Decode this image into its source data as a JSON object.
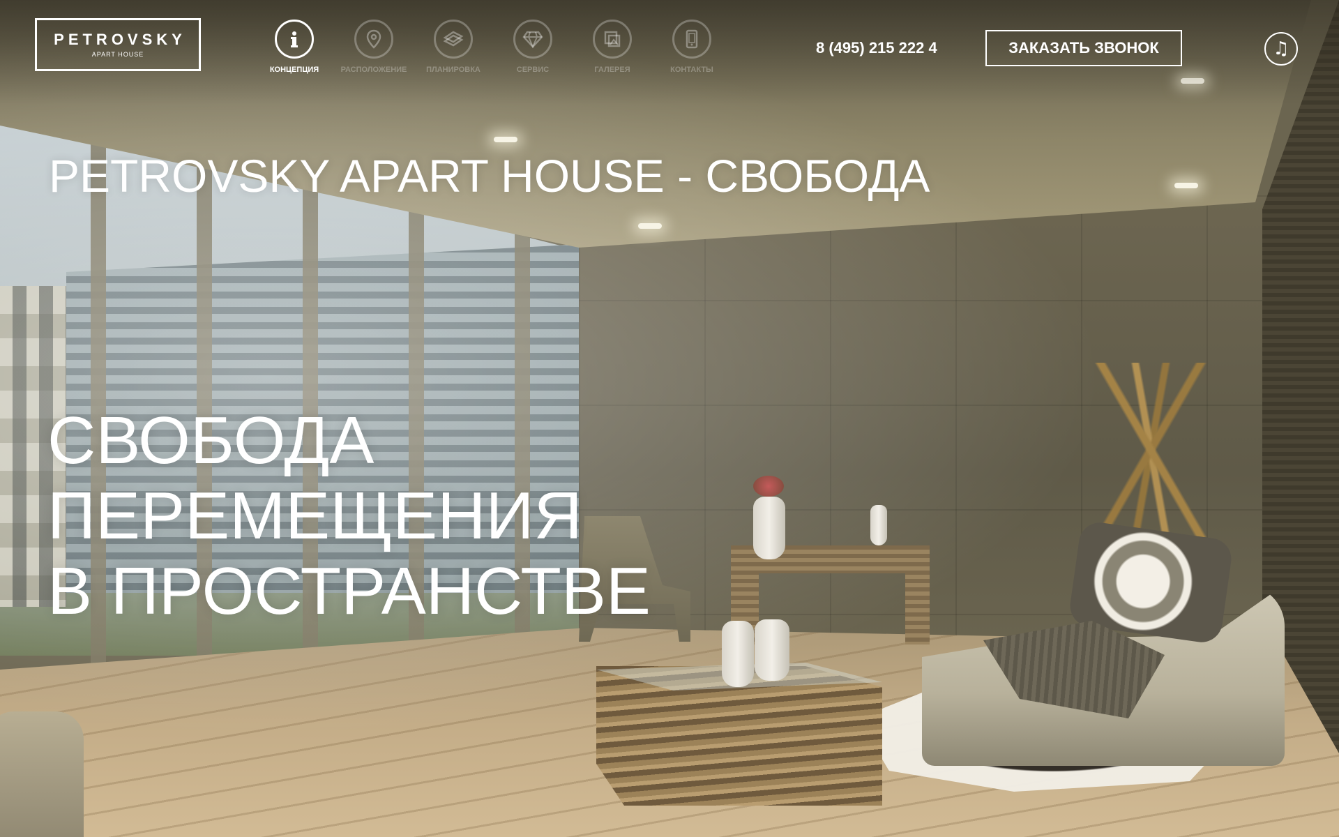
{
  "brand": {
    "name": "PETROVSKY",
    "tagline": "APART HOUSE"
  },
  "nav": {
    "items": [
      {
        "label": "КОНЦЕПЦИЯ",
        "icon": "info-icon",
        "active": true
      },
      {
        "label": "РАСПОЛОЖЕНИЕ",
        "icon": "map-pin-icon",
        "active": false
      },
      {
        "label": "ПЛАНИРОВКА",
        "icon": "floor-plan-icon",
        "active": false
      },
      {
        "label": "СЕРВИС",
        "icon": "diamond-icon",
        "active": false
      },
      {
        "label": "ГАЛЕРЕЯ",
        "icon": "gallery-icon",
        "active": false
      },
      {
        "label": "КОНТАКТЫ",
        "icon": "phone-icon",
        "active": false
      }
    ]
  },
  "header": {
    "phone": "8 (495) 215 222 4",
    "callback_label": "ЗАКАЗАТЬ ЗВОНОК",
    "music_icon": "music-note-icon",
    "music_glyph": "♫"
  },
  "hero": {
    "subheading": "PETROVSKY APART HOUSE - СВОБОДА",
    "headline_lines": [
      "СВОБОДА",
      "ПЕРЕМЕЩЕНИЯ",
      "В ПРОСТРАНСТВЕ"
    ]
  },
  "colors": {
    "text": "#ffffff",
    "inactive_nav": "rgba(255,255,255,0.28)"
  }
}
